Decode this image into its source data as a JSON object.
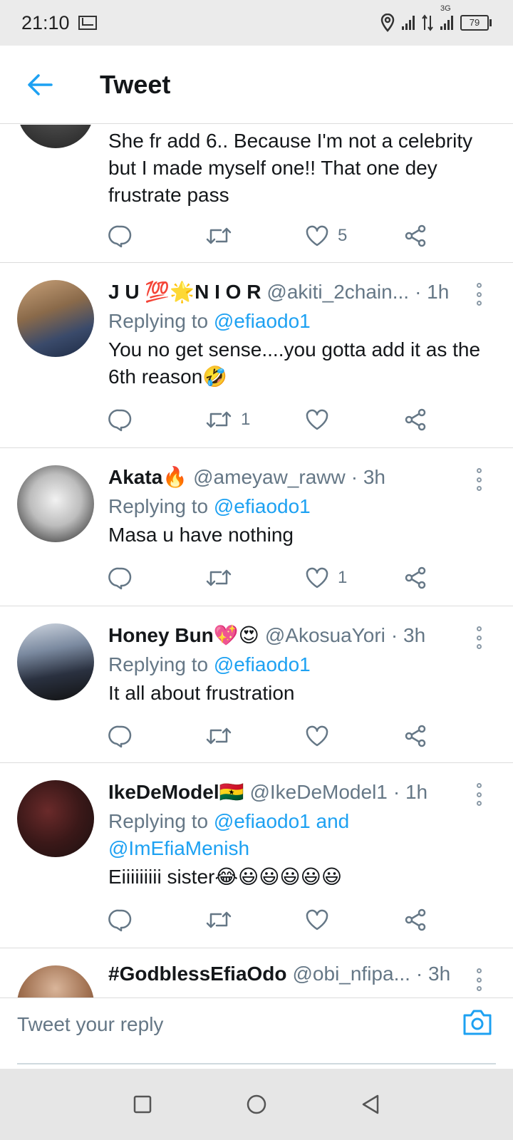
{
  "status_bar": {
    "time": "21:10",
    "network": "3G",
    "battery": "79"
  },
  "header": {
    "title": "Tweet"
  },
  "tweets": [
    {
      "name": "",
      "handle": "",
      "time": "",
      "replying_label": "",
      "replying_to": "",
      "text": "She fr add 6.. Because I'm not a celebrity but I made myself one!! That one dey frustrate pass",
      "reply_count": "",
      "retweet_count": "",
      "like_count": "5"
    },
    {
      "name": "J U 💯🌟N I O R",
      "handle": "@akiti_2chain...",
      "time": "· 1h",
      "replying_label": "Replying to",
      "replying_to": "@efiaodo1",
      "text": "You no get sense....you gotta add it as the 6th reason🤣",
      "reply_count": "",
      "retweet_count": "1",
      "like_count": ""
    },
    {
      "name": "Akata🔥",
      "handle": "@ameyaw_raww",
      "time": "· 3h",
      "replying_label": "Replying to",
      "replying_to": "@efiaodo1",
      "text": "Masa u have nothing",
      "reply_count": "",
      "retweet_count": "",
      "like_count": "1"
    },
    {
      "name": "Honey Bun💖😍",
      "handle": "@AkosuaYori",
      "time": "· 3h",
      "replying_label": "Replying to",
      "replying_to": "@efiaodo1",
      "text": "It all about frustration",
      "reply_count": "",
      "retweet_count": "",
      "like_count": ""
    },
    {
      "name": "IkeDeModel🇬🇭",
      "handle": "@IkeDeModel1",
      "time": "· 1h",
      "replying_label": "Replying to",
      "replying_to": "@efiaodo1 and @ImEfiaMenish",
      "text": "Eiiiiiiiii sister😂😃😃😃😃😃",
      "reply_count": "",
      "retweet_count": "",
      "like_count": ""
    },
    {
      "name": "#GodblessEfiaOdo",
      "handle": "@obi_nfipa...",
      "time": "· 3h",
      "replying_label": "",
      "replying_to": "",
      "text": "",
      "reply_count": "",
      "retweet_count": "",
      "like_count": ""
    }
  ],
  "reply_bar": {
    "placeholder": "Tweet your reply"
  },
  "icons": {
    "back": "arrow-left-icon",
    "reply": "reply-icon",
    "retweet": "retweet-icon",
    "like": "heart-icon",
    "share": "share-icon",
    "more": "more-vertical-icon",
    "camera": "camera-icon"
  },
  "colors": {
    "accent": "#1da1f2",
    "secondary_text": "#657786",
    "primary_text": "#14171a"
  }
}
